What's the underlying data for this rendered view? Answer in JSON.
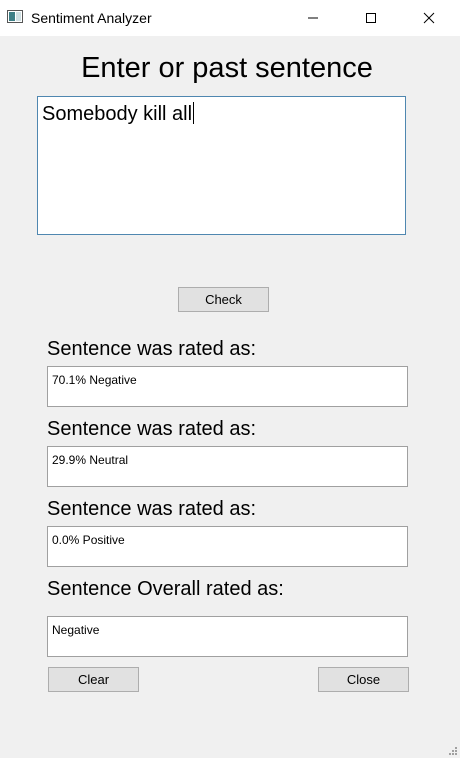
{
  "window": {
    "title": "Sentiment Analyzer",
    "icon": "app-window-icon"
  },
  "title_controls": {
    "minimize_icon": "minimize-icon",
    "maximize_icon": "maximize-icon",
    "close_icon": "close-icon"
  },
  "heading": "Enter or past sentence",
  "sentence_input": {
    "value": "Somebody kill all"
  },
  "check_button": "Check",
  "results": [
    {
      "label": "Sentence was rated as:",
      "value": "70.1% Negative"
    },
    {
      "label": "Sentence was rated as:",
      "value": "29.9% Neutral"
    },
    {
      "label": "Sentence was rated as:",
      "value": "0.0% Positive"
    }
  ],
  "overall": {
    "label": "Sentence Overall rated as:",
    "value": "Negative"
  },
  "buttons": {
    "clear": "Clear",
    "close": "Close"
  },
  "colors": {
    "window_bg": "#f0f0f0",
    "input_focus_border": "#4f87b0",
    "button_bg": "#e1e1e1"
  }
}
